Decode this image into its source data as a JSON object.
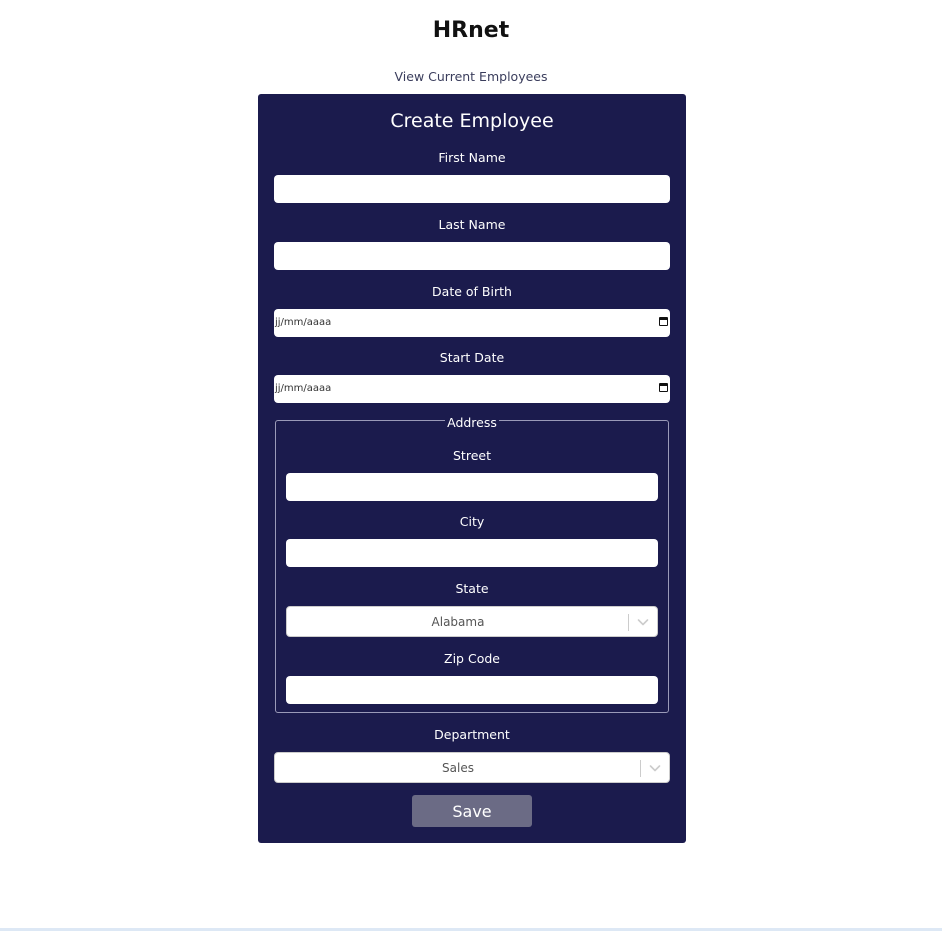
{
  "app": {
    "title": "HRnet",
    "nav_link": "View Current Employees"
  },
  "form": {
    "title": "Create Employee",
    "first_name_label": "First Name",
    "first_name_value": "",
    "last_name_label": "Last Name",
    "last_name_value": "",
    "dob_label": "Date of Birth",
    "dob_placeholder": "jj/mm/aaaa",
    "start_date_label": "Start Date",
    "start_date_placeholder": "jj/mm/aaaa",
    "address": {
      "legend": "Address",
      "street_label": "Street",
      "street_value": "",
      "city_label": "City",
      "city_value": "",
      "state_label": "State",
      "state_selected": "Alabama",
      "zip_label": "Zip Code",
      "zip_value": ""
    },
    "department_label": "Department",
    "department_selected": "Sales",
    "save_label": "Save"
  },
  "colors": {
    "card_background": "#1b1b4d",
    "save_button": "#6b6b85",
    "text_light": "#ffffff"
  },
  "icons": {
    "date_picker": "calendar-icon",
    "select_indicator": "chevron-down-icon"
  }
}
